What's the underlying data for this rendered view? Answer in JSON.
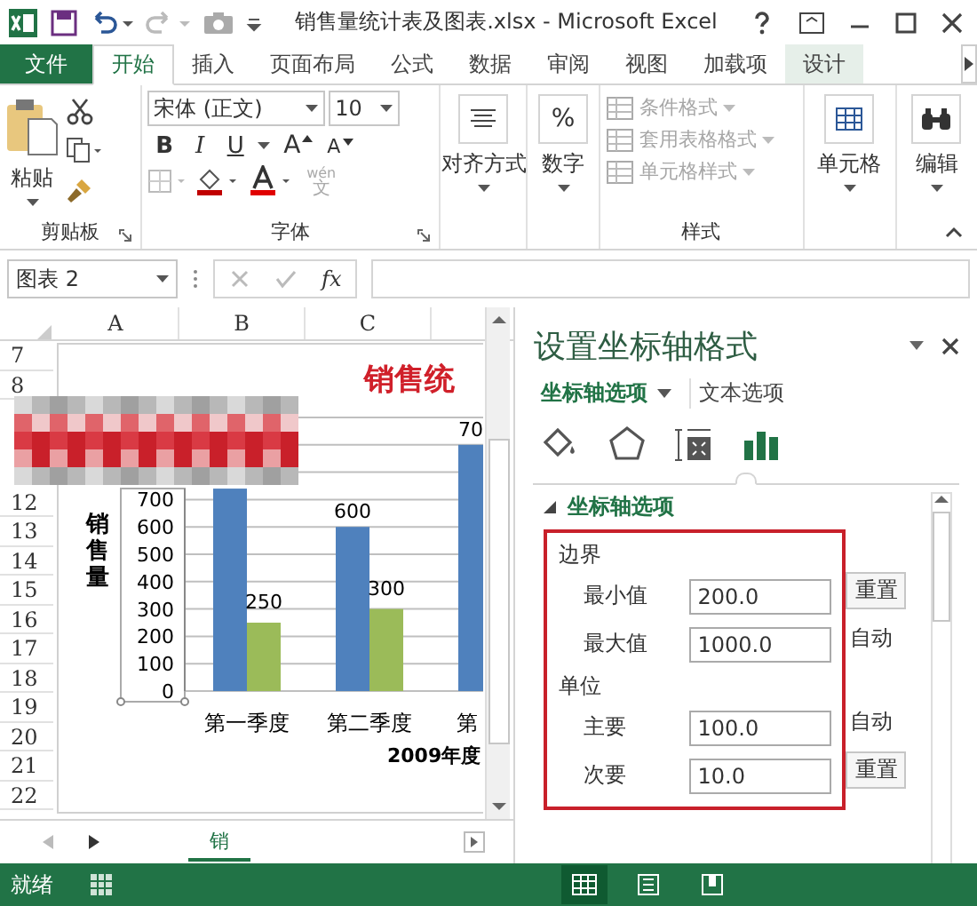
{
  "window": {
    "title": "销售量统计表及图表.xlsx - Microsoft Excel"
  },
  "ribbon_tabs": [
    {
      "label": "文件",
      "kind": "file",
      "selected": false
    },
    {
      "label": "开始",
      "kind": "tab",
      "selected": true
    },
    {
      "label": "插入",
      "kind": "tab",
      "selected": false
    },
    {
      "label": "页面布局",
      "kind": "tab",
      "selected": false
    },
    {
      "label": "公式",
      "kind": "tab",
      "selected": false
    },
    {
      "label": "数据",
      "kind": "tab",
      "selected": false
    },
    {
      "label": "审阅",
      "kind": "tab",
      "selected": false
    },
    {
      "label": "视图",
      "kind": "tab",
      "selected": false
    },
    {
      "label": "加载项",
      "kind": "tab",
      "selected": false
    },
    {
      "label": "设计",
      "kind": "contextual",
      "selected": false
    }
  ],
  "ribbon": {
    "clipboard": {
      "label": "剪贴板",
      "paste": "粘贴"
    },
    "font": {
      "label": "字体",
      "font_name": "宋体 (正文)",
      "font_size": "10",
      "bold": "B",
      "italic": "I",
      "underline": "U",
      "grow": "A",
      "shrink": "A",
      "phonetic": "wén",
      "phonetic_char": "文"
    },
    "alignment": "对齐方式",
    "number": {
      "label": "数字",
      "symbol": "%"
    },
    "styles": {
      "label": "样式",
      "items": [
        {
          "label": "条件格式",
          "disabled": true
        },
        {
          "label": "套用表格格式",
          "disabled": true
        },
        {
          "label": "单元格样式",
          "disabled": true
        }
      ]
    },
    "cells": "单元格",
    "editing": "编辑"
  },
  "formula_bar": {
    "name_box": "图表 2",
    "function_symbol": "fx"
  },
  "sheet": {
    "columns": [
      "A",
      "B",
      "C"
    ],
    "rows": [
      "7",
      "8",
      "12",
      "13",
      "14",
      "15",
      "16",
      "17",
      "18",
      "19",
      "20",
      "21",
      "22"
    ],
    "tabs": [
      {
        "label": "销",
        "selected": true
      }
    ]
  },
  "chart": {
    "chart_data": {
      "type": "bar",
      "title": "销售统",
      "ylabel": "销售量",
      "xlabel": "2009年度",
      "categories": [
        "第一季度",
        "第二季度",
        "第"
      ],
      "ylim": [
        0,
        1000
      ],
      "yticks": [
        0,
        100,
        200,
        300,
        400,
        500,
        600,
        700
      ],
      "grid": true,
      "series": [
        {
          "color": "#4f81bd",
          "values": [
            740,
            600,
            900
          ]
        },
        {
          "color": "#9bbb59",
          "values": [
            250,
            300,
            null
          ]
        }
      ],
      "value_labels": [
        [
          null,
          "600",
          "70"
        ],
        [
          "250",
          "300",
          null
        ]
      ]
    }
  },
  "pane": {
    "title": "设置坐标轴格式",
    "tabs": [
      {
        "label": "坐标轴选项",
        "selected": true
      },
      {
        "label": "文本选项",
        "selected": false
      }
    ],
    "icons": [
      {
        "kind": "fill",
        "selected": false
      },
      {
        "kind": "effects",
        "selected": false
      },
      {
        "kind": "size",
        "selected": false
      },
      {
        "kind": "axis",
        "selected": true
      }
    ],
    "section": {
      "title": "坐标轴选项",
      "expanded": true,
      "groups": [
        {
          "title": "边界",
          "fields": [
            {
              "label": "最小值",
              "value": "200.0",
              "action": "重置",
              "kind": "button"
            },
            {
              "label": "最大值",
              "value": "1000.0",
              "action": "自动",
              "kind": "text"
            }
          ]
        },
        {
          "title": "单位",
          "fields": [
            {
              "label": "主要",
              "value": "100.0",
              "action": "自动",
              "kind": "text"
            },
            {
              "label": "次要",
              "value": "10.0",
              "action": "重置",
              "kind": "button"
            }
          ]
        }
      ]
    }
  },
  "status_bar": {
    "text": "就绪",
    "views": [
      {
        "kind": "normal",
        "selected": true
      },
      {
        "kind": "page_layout",
        "selected": false
      },
      {
        "kind": "page_break",
        "selected": false
      }
    ]
  }
}
